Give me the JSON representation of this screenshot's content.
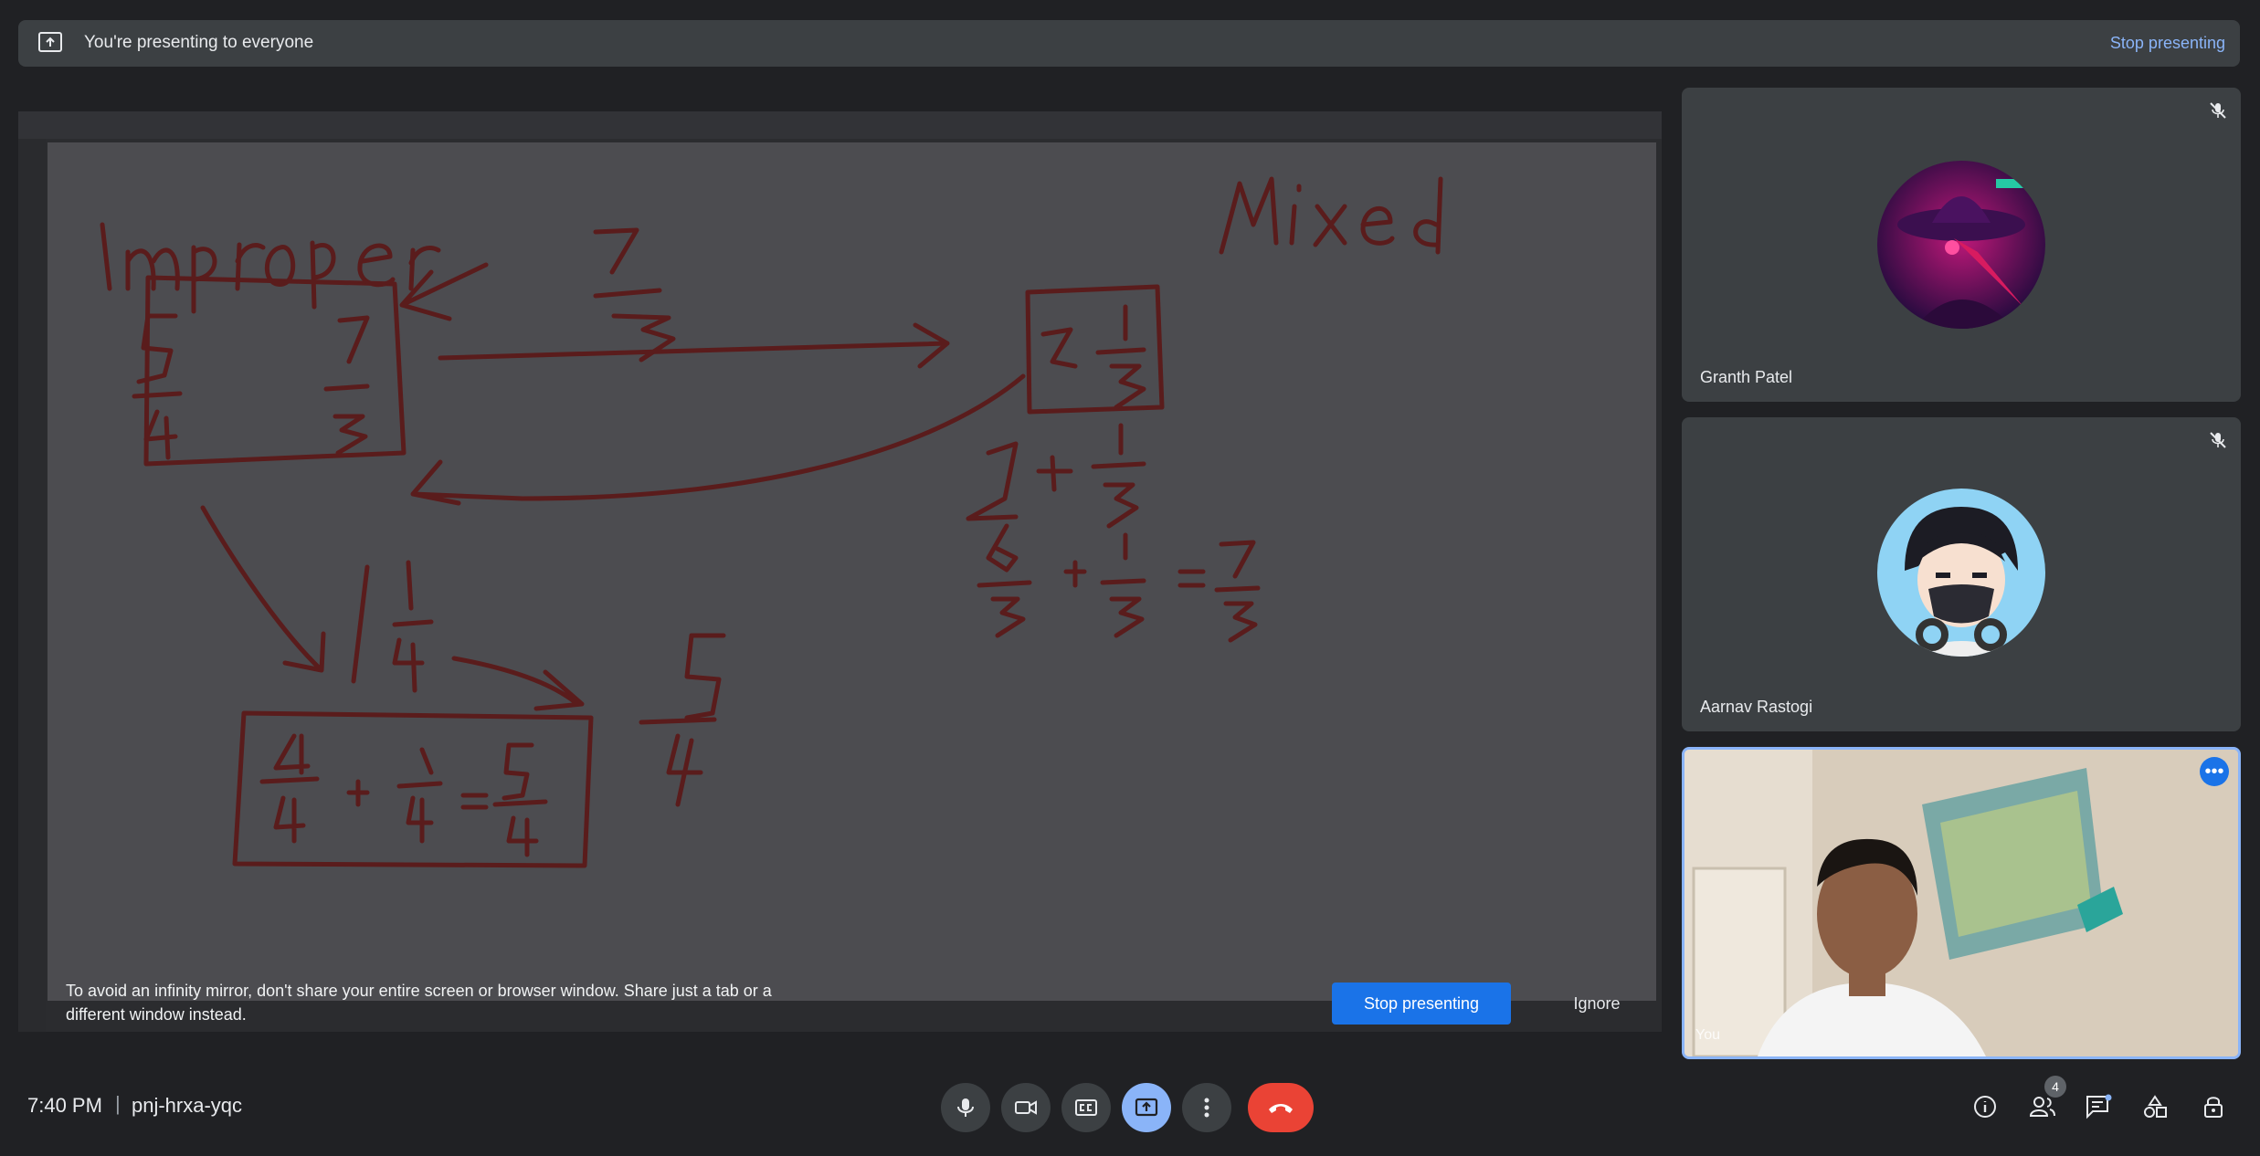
{
  "banner": {
    "message": "You're presenting to everyone",
    "stop_label": "Stop presenting",
    "icon": "present-to-all-icon"
  },
  "whiteboard": {
    "heading_left": "Improper",
    "heading_right": "Mixed",
    "stroke_color": "#5a1c1c"
  },
  "warning": {
    "text": "To avoid an infinity mirror, don't share your entire screen or browser window. Share just a tab or a different window instead.",
    "stop_label": "Stop presenting",
    "ignore_label": "Ignore"
  },
  "participants": [
    {
      "name": "Granth Patel",
      "muted": true,
      "avatar": "plague-doctor-avatar"
    },
    {
      "name": "Aarnav Rastogi",
      "muted": true,
      "avatar": "anime-masked-avatar"
    },
    {
      "name": "You",
      "muted": false,
      "video": "self-camera"
    }
  ],
  "meeting": {
    "time": "7:40 PM",
    "separator": "|",
    "code": "pnj-hrxa-yqc",
    "people_count": "4"
  },
  "controls": [
    "mic-icon",
    "camera-icon",
    "captions-icon",
    "present-icon",
    "more-options-icon",
    "end-call-icon"
  ],
  "right_controls": [
    "info-icon",
    "people-icon",
    "chat-icon",
    "activities-icon",
    "host-controls-icon"
  ],
  "colors": {
    "accent": "#8ab4f8",
    "primary_button": "#1a73e8",
    "end_call": "#ea4335",
    "background": "#202124",
    "surface": "#3c4043"
  }
}
